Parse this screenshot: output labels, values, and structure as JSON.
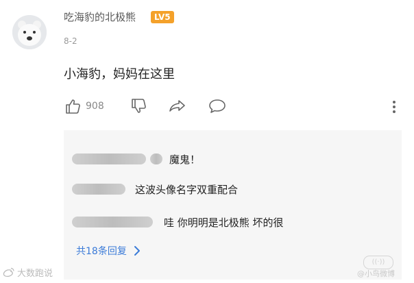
{
  "comment": {
    "username": "吃海豹的北极熊",
    "level_badge": "LV5",
    "date": "8-2",
    "content": "小海豹，妈妈在这里",
    "like_count": "908",
    "icons": [
      "thumbs-up-icon",
      "thumbs-down-icon",
      "share-icon",
      "reply-bubble-icon",
      "more-icon"
    ]
  },
  "replies": {
    "items": [
      {
        "text": "魔鬼！"
      },
      {
        "text": "这波头像名字双重配合"
      },
      {
        "text": "哇  你明明是北极熊  坏的很"
      }
    ],
    "more_label": "共18条回复"
  },
  "watermark": {
    "left": "大数跑说",
    "right": "@小鸟微博"
  },
  "colors": {
    "level_badge": "#f4a12a",
    "link": "#3b7bd8",
    "reply_panel": "#f6f6f6"
  }
}
